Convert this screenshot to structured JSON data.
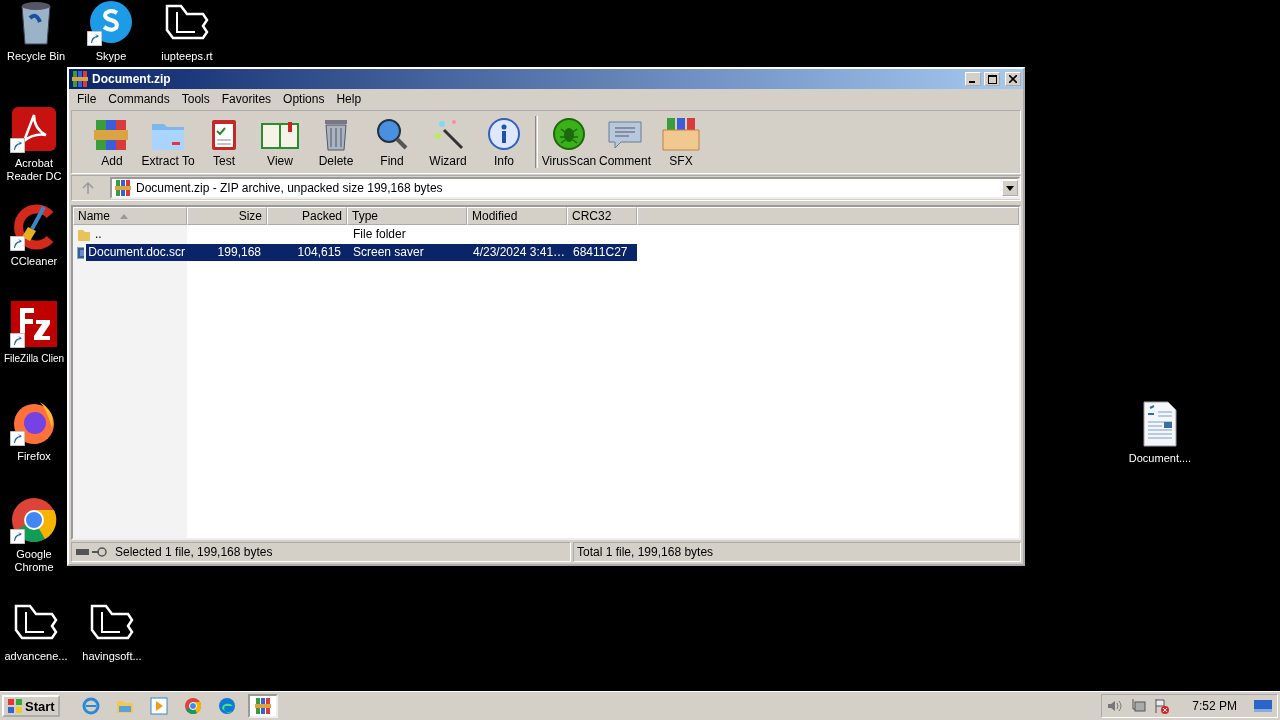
{
  "desktop_icons": [
    {
      "label": "Recycle Bin",
      "kind": "bin",
      "shortcut": false
    },
    {
      "label": "Skype",
      "kind": "skype",
      "shortcut": true
    },
    {
      "label": "iupteeps.rt",
      "kind": "logo",
      "shortcut": false
    },
    {
      "label": "Acrobat Reader DC",
      "kind": "acrobat",
      "shortcut": true
    },
    {
      "label": "CCleaner",
      "kind": "ccleaner",
      "shortcut": true
    },
    {
      "label": "FileZilla Clien",
      "kind": "filezilla",
      "shortcut": true
    },
    {
      "label": "Firefox",
      "kind": "firefox",
      "shortcut": true
    },
    {
      "label": "Google Chrome",
      "kind": "chrome",
      "shortcut": true
    },
    {
      "label": "advancene...",
      "kind": "logo",
      "shortcut": false
    },
    {
      "label": "havingsoft...",
      "kind": "logo",
      "shortcut": false
    },
    {
      "label": "Document....",
      "kind": "document",
      "shortcut": false
    }
  ],
  "window": {
    "title": "Document.zip",
    "menu": [
      "File",
      "Commands",
      "Tools",
      "Favorites",
      "Options",
      "Help"
    ],
    "toolbar": [
      {
        "label": "Add",
        "kind": "add"
      },
      {
        "label": "Extract To",
        "kind": "extract"
      },
      {
        "label": "Test",
        "kind": "test"
      },
      {
        "label": "View",
        "kind": "view"
      },
      {
        "label": "Delete",
        "kind": "delete"
      },
      {
        "label": "Find",
        "kind": "find"
      },
      {
        "label": "Wizard",
        "kind": "wizard"
      },
      {
        "label": "Info",
        "kind": "info"
      },
      {
        "label": "VirusScan",
        "kind": "virus"
      },
      {
        "label": "Comment",
        "kind": "comment"
      },
      {
        "label": "SFX",
        "kind": "sfx"
      }
    ],
    "address": "Document.zip - ZIP archive, unpacked size 199,168 bytes",
    "columns": [
      {
        "label": "Name",
        "sorted": true
      },
      {
        "label": "Size",
        "sorted": false
      },
      {
        "label": "Packed",
        "sorted": false
      },
      {
        "label": "Type",
        "sorted": false
      },
      {
        "label": "Modified",
        "sorted": false
      },
      {
        "label": "CRC32",
        "sorted": false
      }
    ],
    "rows": [
      {
        "kind": "folder",
        "selected": false,
        "cells": {
          "name": "..",
          "type": "File folder"
        }
      },
      {
        "kind": "file",
        "selected": true,
        "cells": {
          "name": "Document.doc.scr",
          "size": "199,168",
          "packed": "104,615",
          "type": "Screen saver",
          "modified": "4/23/2024 3:41…",
          "crc": "68411C27"
        }
      }
    ],
    "status_left": "Selected 1 file, 199,168 bytes",
    "status_right": "Total 1 file, 199,168 bytes"
  },
  "taskbar": {
    "start": "Start",
    "apps": [
      {
        "kind": "ie",
        "active": false
      },
      {
        "kind": "explorer",
        "active": false
      },
      {
        "kind": "media",
        "active": false
      },
      {
        "kind": "chrome",
        "active": false
      },
      {
        "kind": "edge",
        "active": false
      },
      {
        "kind": "winrar",
        "active": true
      }
    ],
    "time": "7:52 PM"
  }
}
